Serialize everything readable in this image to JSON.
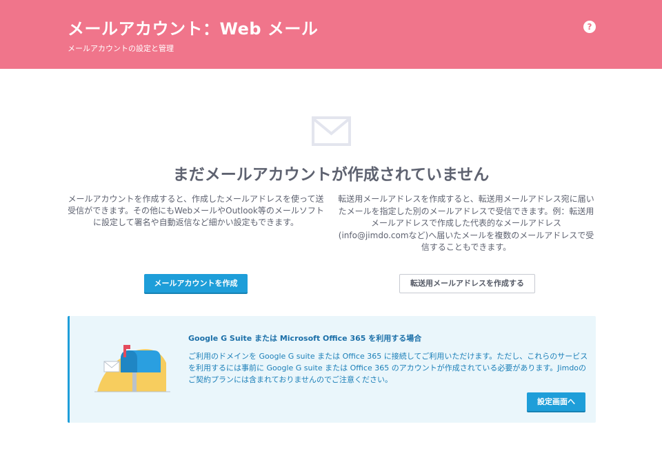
{
  "header": {
    "title": "メールアカウント：Web メール",
    "subtitle": "メールアカウントの設定と管理",
    "help_label": "?"
  },
  "empty_state": {
    "icon": "envelope-icon",
    "title": "まだメールアカウントが作成されていません",
    "left_description": "メールアカウントを作成すると、作成したメールアドレスを使って送受信ができます。その他にもWebメールやOutlook等のメールソフトに設定して署名や自動返信など細かい設定もできます。",
    "right_description": "転送用メールアドレスを作成すると、転送用メールアドレス宛に届いたメールを指定した別のメールアドレスで受信できます。例：転送用メールアドレスで作成した代表的なメールアドレス(info@jimdo.comなど)へ届いたメールを複数のメールアドレスで受信することもできます。",
    "create_account_button": "メールアカウントを作成",
    "create_forwarding_button": "転送用メールアドレスを作成する"
  },
  "info_box": {
    "illustration": "mailbox-illustration",
    "title": "Google G Suite または Microsoft Office 365 を利用する場合",
    "text": "ご利用のドメインを Google G suite または Office 365 に接続してご利用いただけます。ただし、これらのサービスを利用するには事前に Google G suite または Office 365 のアカウントが作成されている必要があります。Jimdoのご契約プランには含まれておりませんのでご注意ください。",
    "settings_button": "設定画面へ"
  },
  "colors": {
    "header_bg": "#f0758b",
    "primary": "#1e9ed9",
    "info_bg": "#eaf6fb",
    "info_text": "#1b7fb8"
  }
}
